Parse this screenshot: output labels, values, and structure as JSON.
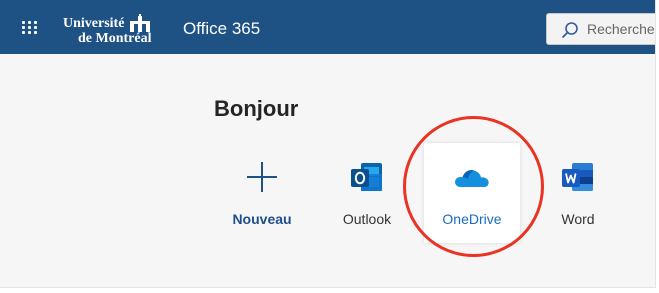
{
  "header": {
    "brand_line1": "Université",
    "brand_line2": "de Montréal",
    "app_title": "Office 365",
    "search_placeholder": "Rechercher",
    "background_color": "#1e5184"
  },
  "main": {
    "greeting": "Bonjour",
    "apps": [
      {
        "label": "Nouveau",
        "icon": "plus-icon"
      },
      {
        "label": "Outlook",
        "icon": "outlook-icon"
      },
      {
        "label": "OneDrive",
        "icon": "onedrive-icon",
        "selected": true
      },
      {
        "label": "Word",
        "icon": "word-icon"
      }
    ]
  },
  "annotation": {
    "circle_color": "#ea3323",
    "highlighted": "OneDrive"
  }
}
